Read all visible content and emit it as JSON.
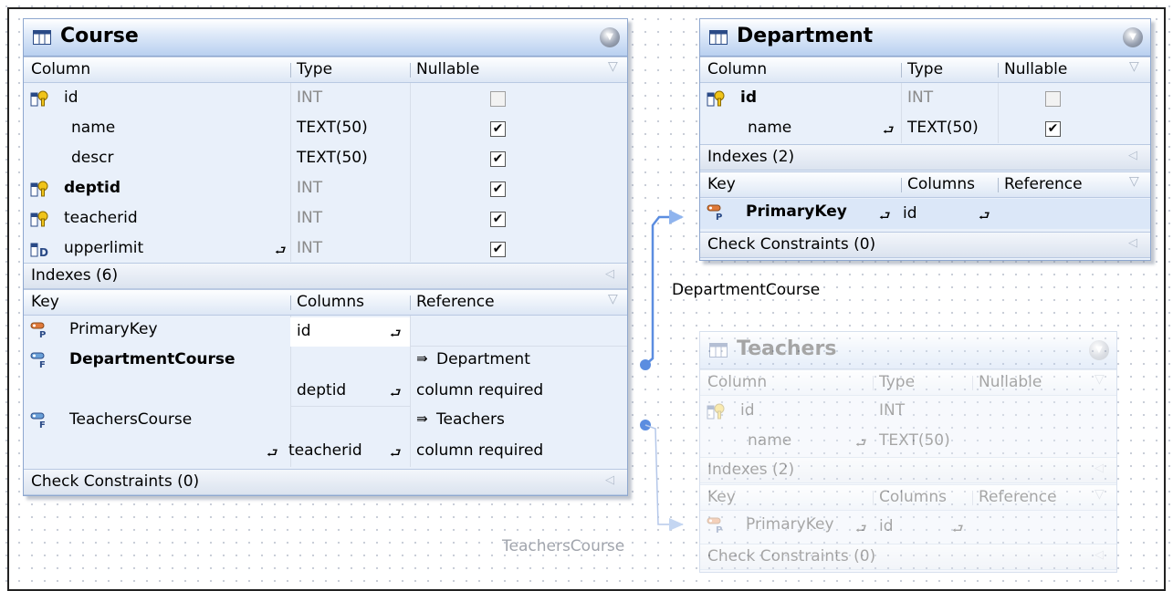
{
  "relations": {
    "department_course": "DepartmentCourse",
    "teachers_course": "TeachersCourse"
  },
  "course": {
    "title": "Course",
    "col_headers": {
      "column": "Column",
      "type": "Type",
      "nullable": "Nullable"
    },
    "columns": [
      {
        "name": "id",
        "type": "INT",
        "nullable": false
      },
      {
        "name": "name",
        "type": "TEXT(50)",
        "nullable": true
      },
      {
        "name": "descr",
        "type": "TEXT(50)",
        "nullable": true
      },
      {
        "name": "deptid",
        "type": "INT",
        "nullable": true
      },
      {
        "name": "teacherid",
        "type": "INT",
        "nullable": true
      },
      {
        "name": "upperlimit",
        "type": "INT",
        "nullable": true
      }
    ],
    "indexes_label": "Indexes (6)",
    "key_headers": {
      "key": "Key",
      "columns": "Columns",
      "reference": "Reference"
    },
    "keys": [
      {
        "name": "PrimaryKey",
        "column": "id",
        "reference": "",
        "reference_note": ""
      },
      {
        "name": "DepartmentCourse",
        "column": "deptid",
        "reference": "Department",
        "reference_note": "column required"
      },
      {
        "name": "TeachersCourse",
        "column": "teacherid",
        "reference": "Teachers",
        "reference_note": "column required"
      }
    ],
    "check_label": "Check Constraints (0)"
  },
  "department": {
    "title": "Department",
    "col_headers": {
      "column": "Column",
      "type": "Type",
      "nullable": "Nullable"
    },
    "columns": [
      {
        "name": "id",
        "type": "INT",
        "nullable": false
      },
      {
        "name": "name",
        "type": "TEXT(50)",
        "nullable": true
      }
    ],
    "indexes_label": "Indexes (2)",
    "key_headers": {
      "key": "Key",
      "columns": "Columns",
      "reference": "Reference"
    },
    "keys": [
      {
        "name": "PrimaryKey",
        "column": "id"
      }
    ],
    "check_label": "Check Constraints (0)"
  },
  "teachers": {
    "title": "Teachers",
    "col_headers": {
      "column": "Column",
      "type": "Type",
      "nullable": "Nullable"
    },
    "columns": [
      {
        "name": "id",
        "type": "INT"
      },
      {
        "name": "name",
        "type": "TEXT(50)"
      }
    ],
    "indexes_label": "Indexes (2)",
    "key_headers": {
      "key": "Key",
      "columns": "Columns",
      "reference": "Reference"
    },
    "keys": [
      {
        "name": "PrimaryKey",
        "column": "id"
      }
    ],
    "check_label": "Check Constraints (0)"
  },
  "colors": {
    "connector": "#5b8de0",
    "header_blue": "#b9d0f0",
    "body": "#e9f0fa"
  },
  "icons": [
    "table-icon",
    "key-column-icon",
    "foreign-key-column-icon",
    "primary-key-icon",
    "foreign-key-icon",
    "expand-icon",
    "reference-table-icon",
    "collapse-icon"
  ]
}
